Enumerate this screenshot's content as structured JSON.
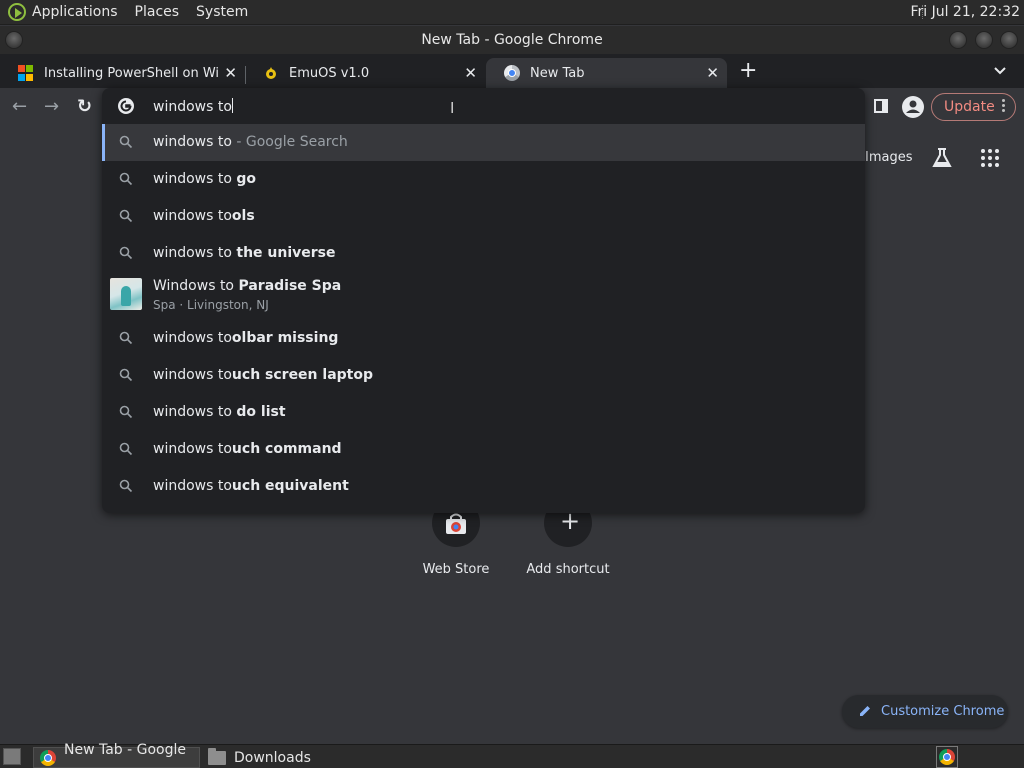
{
  "desktop": {
    "menus": [
      "Applications",
      "Places",
      "System"
    ],
    "clock": "Fri Jul 21, 22:32"
  },
  "window": {
    "title": "New Tab - Google Chrome"
  },
  "tabs": [
    {
      "title": "Installing PowerShell on Wind",
      "close": "✕"
    },
    {
      "title": "EmuOS v1.0",
      "close": "✕"
    },
    {
      "title": "New Tab",
      "close": "✕"
    }
  ],
  "tabstrip": {
    "new_tab": "+",
    "tab_search": "⌄"
  },
  "toolbar": {
    "back": "←",
    "forward": "→",
    "reload": "↻",
    "update_label": "Update"
  },
  "omnibox": {
    "typed": "windows to",
    "suggestions": [
      {
        "prefix": "windows to",
        "completion": "",
        "suffix": " - Google Search",
        "icon": "search-icon"
      },
      {
        "prefix": "windows to ",
        "completion": "go",
        "icon": "search-icon"
      },
      {
        "prefix": "windows to",
        "completion": "ols",
        "icon": "search-icon"
      },
      {
        "prefix": "windows to ",
        "completion": "the universe",
        "icon": "search-icon"
      },
      {
        "prefix": "Windows to ",
        "completion": "Paradise Spa",
        "sub": "Spa · Livingston, NJ",
        "icon": "place-thumbnail"
      },
      {
        "prefix": "windows to",
        "completion": "olbar missing",
        "icon": "search-icon"
      },
      {
        "prefix": "windows to",
        "completion": "uch screen laptop",
        "icon": "search-icon"
      },
      {
        "prefix": "windows to ",
        "completion": "do list",
        "icon": "search-icon"
      },
      {
        "prefix": "windows to",
        "completion": "uch command",
        "icon": "search-icon"
      },
      {
        "prefix": "windows to",
        "completion": "uch equivalent",
        "icon": "search-icon"
      }
    ]
  },
  "ntp": {
    "images_link": "Images",
    "shortcuts": [
      {
        "label": "Web Store",
        "icon": "web-store-icon"
      },
      {
        "label": "Add shortcut",
        "icon": "plus-icon",
        "glyph": "+"
      }
    ],
    "customize_label": "Customize Chrome"
  },
  "taskbar": {
    "items": [
      {
        "label": "New Tab - Google ..."
      },
      {
        "label": "Downloads"
      }
    ]
  },
  "colors": {
    "accent": "#8ab4f8",
    "update": "#f28b82",
    "background": "#35363a",
    "omnibox": "#202124"
  }
}
